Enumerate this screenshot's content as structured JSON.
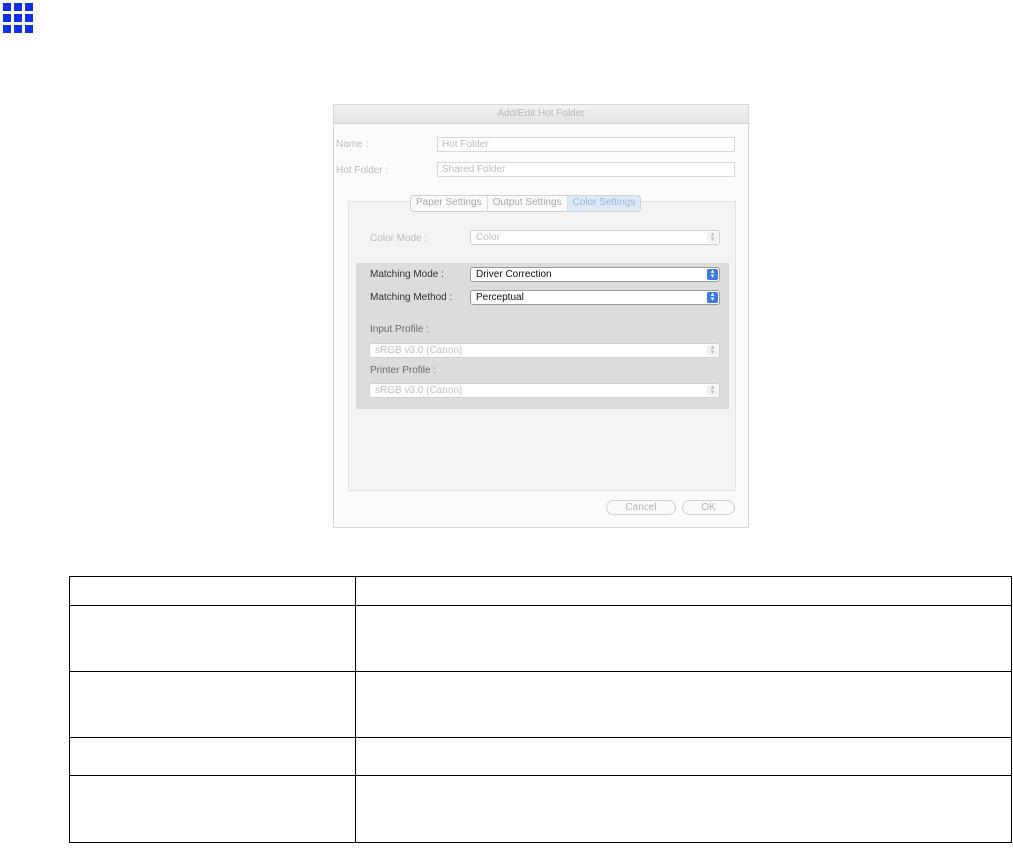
{
  "icon": {
    "name": "grid-icon",
    "color": "#1030e8"
  },
  "dialog": {
    "title": "Add/Edit Hot Folder",
    "name_label": "Name :",
    "name_value": "Hot Folder",
    "hotfolder_label": "Hot Folder :",
    "hotfolder_value": "Shared Folder",
    "tabs": [
      "Paper Settings",
      "Output Settings",
      "Color Settings"
    ],
    "color_mode_label": "Color Mode :",
    "color_mode_value": "Color",
    "matching_mode_label": "Matching Mode :",
    "matching_mode_value": "Driver Correction",
    "matching_method_label": "Matching Method :",
    "matching_method_value": "Perceptual",
    "input_profile_label": "Input Profile :",
    "input_profile_value": "sRGB v3.0 (Canon)",
    "printer_profile_label": "Printer Profile :",
    "printer_profile_value": "sRGB v3.0 (Canon)",
    "cancel_label": "Cancel",
    "ok_label": "OK"
  },
  "table": {
    "rows": [
      [
        "",
        ""
      ],
      [
        "",
        ""
      ],
      [
        "",
        ""
      ],
      [
        "",
        ""
      ],
      [
        "",
        ""
      ]
    ]
  }
}
